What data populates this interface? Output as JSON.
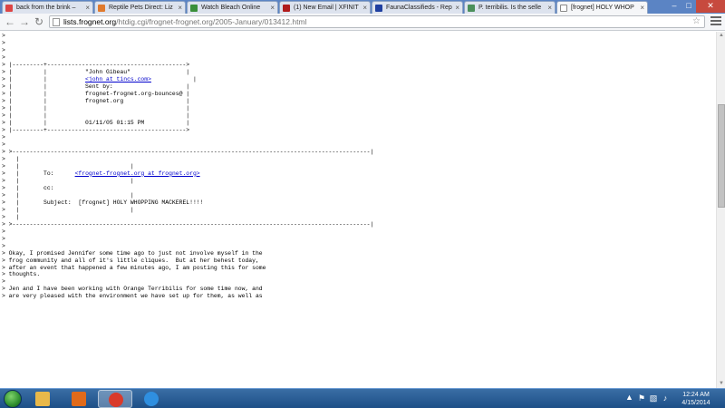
{
  "tabs": [
    {
      "label": "back from the brink –",
      "icon_color": "#d44",
      "active": false
    },
    {
      "label": "Reptile Pets Direct: Liz",
      "icon_color": "#e07a2d",
      "active": false
    },
    {
      "label": "Watch Bleach Online",
      "icon_color": "#3a8f3a",
      "active": false
    },
    {
      "label": "(1) New Email | XFINIT",
      "icon_color": "#b01c1c",
      "active": false
    },
    {
      "label": "FaunaClassifieds - Rep",
      "icon_color": "#1f3fa0",
      "active": false
    },
    {
      "label": "P. terribilis. Is the selle",
      "icon_color": "#4a8f5a",
      "active": false
    },
    {
      "label": "[frognet] HOLY WHOP",
      "icon_color": "#ffffff",
      "active": true
    }
  ],
  "window_controls": {
    "minimize": "–",
    "restore": "□",
    "close": "✕"
  },
  "toolbar": {
    "back_icon": "←",
    "forward_icon": "→",
    "reload_icon": "↻",
    "url_host": "lists.frognet.org",
    "url_path": "/htdig.cgi/frognet-frognet.org/2005-January/013412.html",
    "star_icon": "☆"
  },
  "email": {
    "from_name": "\"John Gibeau\"",
    "from_email": "<john at tincs.com>",
    "sent_by_label": "Sent by:",
    "sent_by_line1": "frognet-frognet.org-bounces@",
    "sent_by_line2": "frognet.org",
    "date": "01/11/05 01:15 PM",
    "to_label": "To:",
    "to_value": "<frognet-frognet.org at frognet.org>",
    "cc_label": "cc:",
    "subject_label": "Subject:",
    "subject_value": "[frognet] HOLY WHOPPING MACKEREL!!!!",
    "body_lines": [
      "Okay, I promised Jennifer some time ago to just not involve myself in the",
      "frog community and all of it's little cliques.  But at her behest today,",
      "after an event that happened a few minutes ago, I am posting this for some",
      "thoughts.",
      "",
      "Jen and I have been working with Orange Terribilis for some time now, and",
      "are very pleased with the environment we have set up for them, as well as"
    ]
  },
  "taskbar": {
    "apps": [
      {
        "name": "folder",
        "color": "#e8b84a",
        "active": false
      },
      {
        "name": "media-player",
        "color": "#e06a1a",
        "active": false
      },
      {
        "name": "chrome",
        "color": "#d93a2b",
        "active": true
      },
      {
        "name": "internet-explorer",
        "color": "#2f8fe0",
        "active": false
      }
    ],
    "tray_arrow": "▲",
    "time": "12:24 AM",
    "date": "4/15/2014"
  }
}
